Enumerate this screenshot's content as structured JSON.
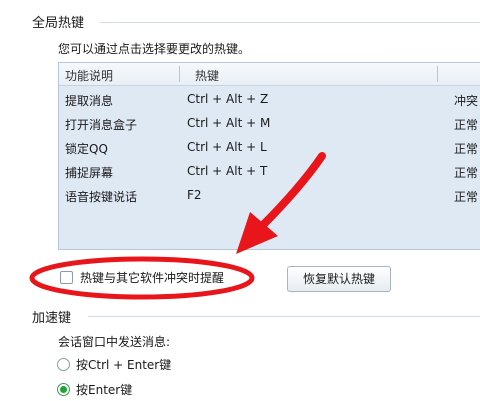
{
  "global_hotkeys": {
    "section_title": "全局热键",
    "hint": "您可以通过点击选择要更改的热键。",
    "table": {
      "headers": [
        "功能说明",
        "热键",
        ""
      ],
      "rows": [
        {
          "func": "提取消息",
          "key": "Ctrl + Alt + Z",
          "status": "冲突"
        },
        {
          "func": "打开消息盒子",
          "key": "Ctrl + Alt + M",
          "status": "正常"
        },
        {
          "func": "锁定QQ",
          "key": "Ctrl + Alt + L",
          "status": "正常"
        },
        {
          "func": "捕捉屏幕",
          "key": "Ctrl + Alt + T",
          "status": "正常"
        },
        {
          "func": "语音按键说话",
          "key": "F2",
          "status": "正常"
        }
      ]
    },
    "conflict_checkbox_label": "热键与其它软件冲突时提醒",
    "restore_button": "恢复默认热键"
  },
  "accel_keys": {
    "section_title": "加速键",
    "send_label": "会话窗口中发送消息:",
    "options": [
      {
        "label": "按Ctrl + Enter键",
        "selected": false
      },
      {
        "label": "按Enter键",
        "selected": true
      }
    ]
  },
  "annotation": {
    "color": "#e8151b"
  }
}
